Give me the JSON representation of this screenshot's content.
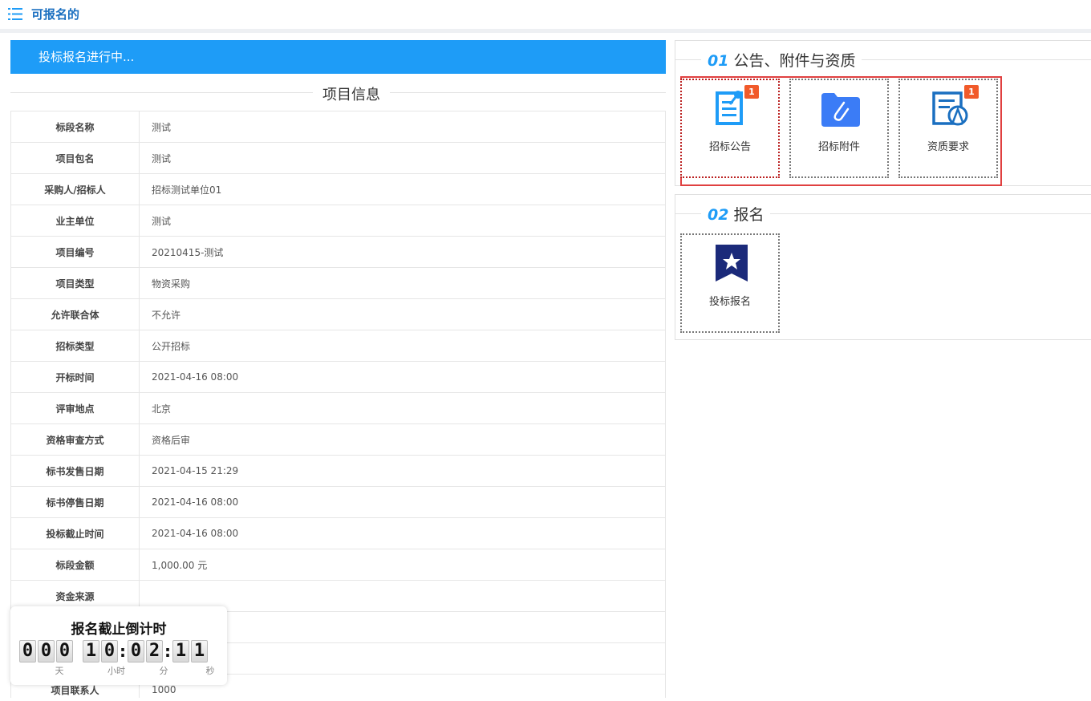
{
  "header": {
    "title": "可报名的",
    "menu_icon": "list-icon"
  },
  "banner": {
    "text": "投标报名进行中..."
  },
  "project_section": {
    "title": "项目信息"
  },
  "project_rows": [
    {
      "label": "标段名称",
      "value": "测试"
    },
    {
      "label": "项目包名",
      "value": "测试"
    },
    {
      "label": "采购人/招标人",
      "value": "招标测试单位01"
    },
    {
      "label": "业主单位",
      "value": "测试"
    },
    {
      "label": "项目编号",
      "value": "20210415-测试"
    },
    {
      "label": "项目类型",
      "value": "物资采购"
    },
    {
      "label": "允许联合体",
      "value": "不允许"
    },
    {
      "label": "招标类型",
      "value": "公开招标"
    },
    {
      "label": "开标时间",
      "value": "2021-04-16 08:00"
    },
    {
      "label": "评审地点",
      "value": "北京"
    },
    {
      "label": "资格审查方式",
      "value": "资格后审"
    },
    {
      "label": "标书发售日期",
      "value": "2021-04-15 21:29"
    },
    {
      "label": "标书停售日期",
      "value": "2021-04-16 08:00"
    },
    {
      "label": "投标截止时间",
      "value": "2021-04-16 08:00"
    },
    {
      "label": "标段金额",
      "value": "1,000.00 元"
    },
    {
      "label": "资金来源",
      "value": ""
    },
    {
      "label": "",
      "value": ""
    },
    {
      "label": "",
      "value": ""
    },
    {
      "label": "项目联系人",
      "value": "1000"
    }
  ],
  "countdown": {
    "title": "报名截止倒计时",
    "days": "000",
    "hours": "10",
    "minutes": "02",
    "seconds": "11",
    "unit_day": "天",
    "unit_hour": "小时",
    "unit_min": "分",
    "unit_sec": "秒"
  },
  "section1": {
    "number": "01",
    "title": "公告、附件与资质",
    "tiles": [
      {
        "label": "招标公告",
        "icon": "announcement-icon",
        "badge": "1"
      },
      {
        "label": "招标附件",
        "icon": "attachment-folder-icon",
        "badge": ""
      },
      {
        "label": "资质要求",
        "icon": "qualification-icon",
        "badge": "1"
      }
    ]
  },
  "section2": {
    "number": "02",
    "title": "报名",
    "tiles": [
      {
        "label": "投标报名",
        "icon": "bookmark-star-icon"
      }
    ]
  },
  "colors": {
    "accent": "#1e9cf7",
    "title_blue": "#1a6fc0",
    "badge": "#f15a2a",
    "highlight": "#e04040"
  }
}
